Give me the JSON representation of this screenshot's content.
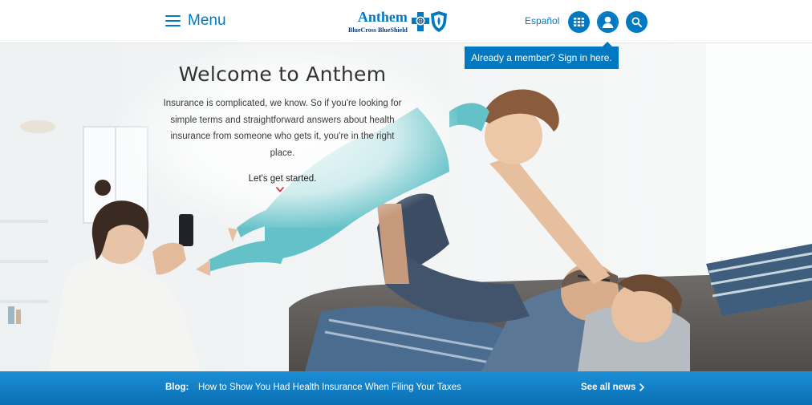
{
  "header": {
    "menu_label": "Menu",
    "logo": {
      "name": "Anthem",
      "subline": "BlueCross BlueShield",
      "marks": [
        "bluecross-icon",
        "blueshield-icon"
      ]
    },
    "language_link": "Español",
    "icons": {
      "apps": "grid-icon",
      "account": "user-icon",
      "search": "search-icon"
    }
  },
  "tooltip": {
    "text": "Already a member? Sign in here."
  },
  "hero": {
    "title": "Welcome to Anthem",
    "body": "Insurance is complicated, we know. So if you're looking for simple terms and straightforward answers about health insurance from someone who gets it, you're in the right place.",
    "cta": "Let's get started."
  },
  "blog": {
    "label": "Blog:",
    "headline": "How to Show You Had Health Insurance When Filing Your Taxes",
    "see_all": "See all news"
  },
  "colors": {
    "brand_blue": "#0079c2",
    "dark_blue": "#0b3b73",
    "cta_accent": "#e0393e"
  }
}
